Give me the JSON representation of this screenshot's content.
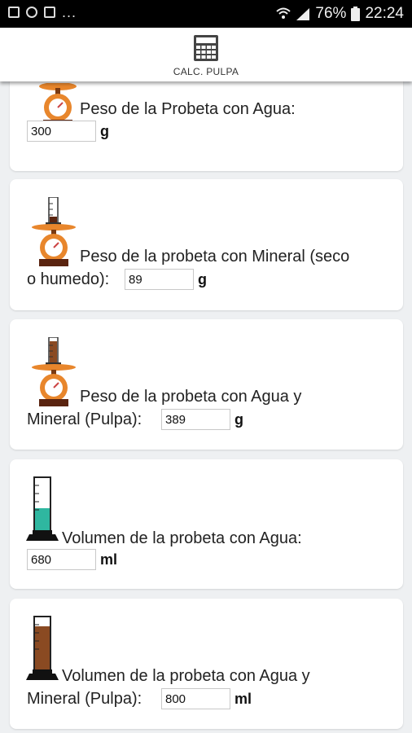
{
  "status_bar": {
    "battery": "76%",
    "time": "22:24",
    "dots": "..."
  },
  "app_bar": {
    "title": "CALC. PULPA",
    "icon": "calculator-icon"
  },
  "cards": [
    {
      "label": "Peso de la Probeta con Agua:",
      "value": "300",
      "unit": "g",
      "icon": "scale-icon"
    },
    {
      "label_line1": "Peso de la probeta con Mineral (seco",
      "label_line2": "o humedo):",
      "value": "89",
      "unit": "g",
      "icon": "scale-with-cylinder-icon"
    },
    {
      "label_line1": "Peso de la probeta con Agua y",
      "label_line2": "Mineral (Pulpa):",
      "value": "389",
      "unit": "g",
      "icon": "scale-with-pulp-cylinder-icon"
    },
    {
      "label": "Volumen de la probeta con Agua:",
      "value": "680",
      "unit": "ml",
      "icon": "cylinder-water-icon"
    },
    {
      "label_line1": "Volumen de la probeta con Agua y",
      "label_line2": "Mineral (Pulpa):",
      "value": "800",
      "unit": "ml",
      "icon": "cylinder-pulp-icon"
    }
  ]
}
